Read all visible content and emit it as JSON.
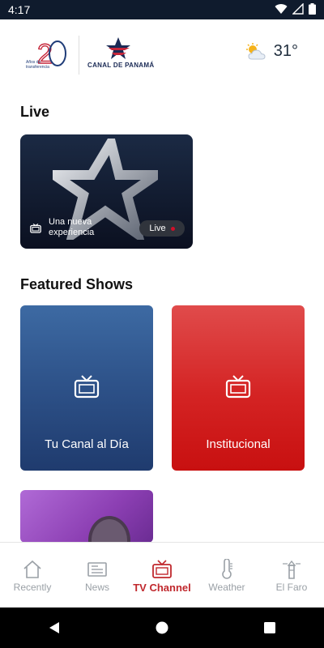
{
  "status": {
    "time": "4:17"
  },
  "header": {
    "logo_left_small_text": "Años de transferencia",
    "logo_right_text": "CANAL DE PANAMÁ",
    "weather_temp": "31°",
    "weather_icon": "partly-cloudy-icon"
  },
  "live": {
    "title": "Live",
    "caption": "Una nueva experiencia",
    "badge": "Live",
    "badge_color": "#d0102a"
  },
  "featured": {
    "title": "Featured Shows",
    "shows": [
      {
        "label": "Tu Canal al Día"
      },
      {
        "label": "Institucional"
      },
      {
        "label": ""
      }
    ]
  },
  "nav": {
    "active_color": "#c0282d",
    "items": [
      {
        "label": "Recently",
        "icon": "home-icon"
      },
      {
        "label": "News",
        "icon": "news-icon"
      },
      {
        "label": "TV Channel",
        "icon": "tv-icon"
      },
      {
        "label": "Weather",
        "icon": "thermometer-icon"
      },
      {
        "label": "El Faro",
        "icon": "lighthouse-icon"
      }
    ],
    "active_index": 2
  }
}
